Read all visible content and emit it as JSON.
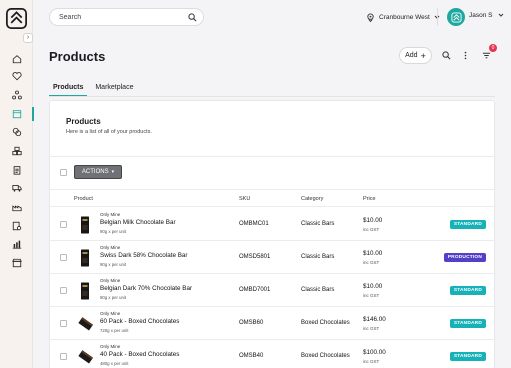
{
  "colors": {
    "accent": "#1fa8a0",
    "standard_badge": "#16b2b8",
    "production_badge": "#5240c8",
    "notification": "#e8344e"
  },
  "sidebar": {
    "logo_icon": "brand-logo-icon",
    "collapse_glyph": "›",
    "items": [
      {
        "name": "home",
        "icon": "home-icon"
      },
      {
        "name": "favorites",
        "icon": "heart-icon"
      },
      {
        "name": "network",
        "icon": "network-icon"
      },
      {
        "name": "products",
        "icon": "box-icon",
        "active": true
      },
      {
        "name": "money",
        "icon": "coins-icon"
      },
      {
        "name": "inventory",
        "icon": "boxes-icon"
      },
      {
        "name": "documents",
        "icon": "clipboard-icon"
      },
      {
        "name": "delivery",
        "icon": "truck-icon"
      },
      {
        "name": "operations",
        "icon": "factory-icon"
      },
      {
        "name": "settings",
        "icon": "gear-doc-icon"
      },
      {
        "name": "reports",
        "icon": "bar-chart-icon"
      },
      {
        "name": "store",
        "icon": "storefront-icon"
      }
    ]
  },
  "topbar": {
    "search": {
      "placeholder": "Search",
      "value": ""
    },
    "location": "Cranbourne West",
    "user": "Jason S"
  },
  "page": {
    "title": "Products",
    "add_label": "Add",
    "filter_count": "0"
  },
  "tabs": [
    {
      "label": "Products",
      "active": true
    },
    {
      "label": "Marketplace",
      "active": false
    }
  ],
  "card": {
    "title": "Products",
    "subtitle": "Here is a list of all of your products.",
    "actions_label": "ACTIONS",
    "columns": {
      "product": "Product",
      "sku": "SKU",
      "category": "Category",
      "price": "Price"
    }
  },
  "rows": [
    {
      "brand": "Only Mine",
      "name": "Belgian Milk Chocolate Bar",
      "desc": "90g x per unit",
      "sku": "OMBMC01",
      "category": "Classic Bars",
      "price": "$10.00",
      "tax": "inc GST",
      "badge": "STANDARD",
      "badge_type": "standard",
      "thumb": "chocolate-bar-image"
    },
    {
      "brand": "Only Mine",
      "name": "Swiss Dark 58% Chocolate Bar",
      "desc": "90g x per unit",
      "sku": "OMSD5801",
      "category": "Classic Bars",
      "price": "$10.00",
      "tax": "inc GST",
      "badge": "PRODUCTION",
      "badge_type": "production",
      "thumb": "chocolate-bar-image"
    },
    {
      "brand": "Only Mine",
      "name": "Belgian Dark 70% Chocolate Bar",
      "desc": "90g x per unit",
      "sku": "OMBD7001",
      "category": "Classic Bars",
      "price": "$10.00",
      "tax": "inc GST",
      "badge": "STANDARD",
      "badge_type": "standard",
      "thumb": "chocolate-bar-image"
    },
    {
      "brand": "Only Mine",
      "name": "60 Pack - Boxed Chocolates",
      "desc": "720g x per unit",
      "sku": "OMSB60",
      "category": "Boxed Chocolates",
      "price": "$146.00",
      "tax": "inc GST",
      "badge": "STANDARD",
      "badge_type": "standard",
      "thumb": "chocolate-box-image"
    },
    {
      "brand": "Only Mine",
      "name": "40 Pack - Boxed Chocolates",
      "desc": "480g x per unit",
      "sku": "OMSB40",
      "category": "Boxed Chocolates",
      "price": "$100.00",
      "tax": "inc GST",
      "badge": "STANDARD",
      "badge_type": "standard",
      "thumb": "chocolate-box-image"
    }
  ]
}
